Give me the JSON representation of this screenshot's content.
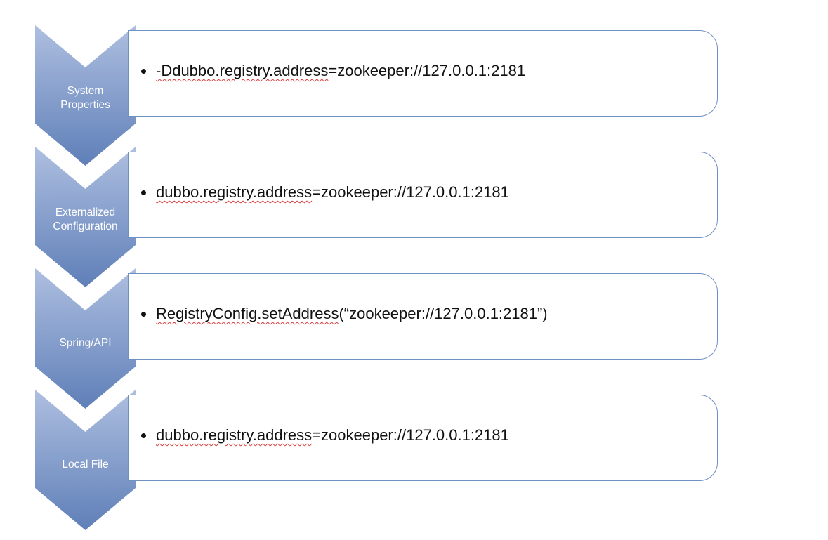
{
  "colors": {
    "chevron_light": "#aebfe0",
    "chevron_dark": "#5f7fb8",
    "box_border": "#6f90c2",
    "spellcheck": "#d83a3a"
  },
  "steps": [
    {
      "label": "System\nProperties",
      "text_underlined": "-Ddubbo.registry.address",
      "text_rest": "=zookeeper://127.0.0.1:2181"
    },
    {
      "label": "Externalized\nConfiguration",
      "text_underlined": "dubbo.registry.address",
      "text_rest": "=zookeeper://127.0.0.1:2181"
    },
    {
      "label": "Spring/API",
      "text_underlined": "RegistryConfig.setAddress",
      "text_rest": "(“zookeeper://127.0.0.1:2181”)"
    },
    {
      "label": "Local File",
      "text_underlined": "dubbo.registry.address",
      "text_rest": "=zookeeper://127.0.0.1:2181"
    }
  ]
}
